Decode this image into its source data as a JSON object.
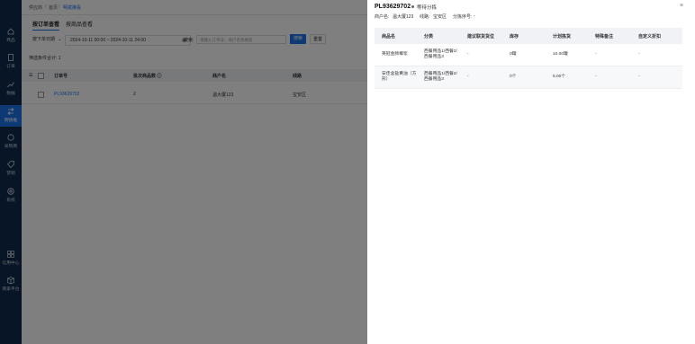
{
  "sidebar": {
    "items": [
      {
        "label": "商品",
        "icon": "home-icon"
      },
      {
        "label": "订单",
        "icon": "document-icon"
      },
      {
        "label": "数据",
        "icon": "chart-icon"
      },
      {
        "label": "明拨推",
        "icon": "swap-icon",
        "active": true
      },
      {
        "label": "采购商",
        "icon": "bag-icon"
      },
      {
        "label": "营销",
        "icon": "tag-icon"
      },
      {
        "label": "系统",
        "icon": "gear-icon"
      },
      {
        "label": "信用中心",
        "icon": "grid-icon"
      },
      {
        "label": "商家平台",
        "icon": "box-icon"
      }
    ]
  },
  "breadcrumb": [
    "供应商",
    "首页",
    "明拨推看"
  ],
  "tabs": [
    "按订单查看",
    "按商品查看"
  ],
  "filters": {
    "date_type": "按下单日期",
    "date_range": "2024-10-11 00:00 ~ 2024-10-11 24:00",
    "search_label": "搜索:",
    "search_placeholder": "请输入订单号、商户名称搜索",
    "search_button": "搜索",
    "reset_button": "重置"
  },
  "selected_text": "筛选条件合计: 1",
  "table": {
    "headers": [
      "订单号",
      "批次商品数 ⓘ",
      "商户名",
      "线路"
    ],
    "rows": [
      {
        "order": "PL93629702",
        "count": "2",
        "merchant": "温大厦123",
        "route": "宝安区"
      }
    ]
  },
  "drawer": {
    "order_id": "PL93629702",
    "status": "等待分拣",
    "merchant_label": "商户名:",
    "merchant": "温大厦123",
    "route_label": "线路:",
    "route": "宝安区",
    "sort_label": "分拣序号:",
    "sort_value": "-",
    "headers": [
      "商品名",
      "分类",
      "建议联货货位",
      "库存",
      "计划拣货",
      "特殊备注",
      "自定义折扣"
    ],
    "rows": [
      {
        "name": "英冠金牌椰浆",
        "category_1": "西餐用品1/西餐2/",
        "category_2": "西餐用品3",
        "suggest": "-",
        "stock": "0罐",
        "plan": "10.00罐",
        "note": "-",
        "discount": "-"
      },
      {
        "name_1": "安佳含盐黄油（方",
        "name_2": "形）",
        "category_1": "西餐用品1/西餐2/",
        "category_2": "西餐用品3",
        "suggest": "-",
        "stock": "0个",
        "plan": "5.00个",
        "note": "-",
        "discount": "-"
      }
    ]
  }
}
